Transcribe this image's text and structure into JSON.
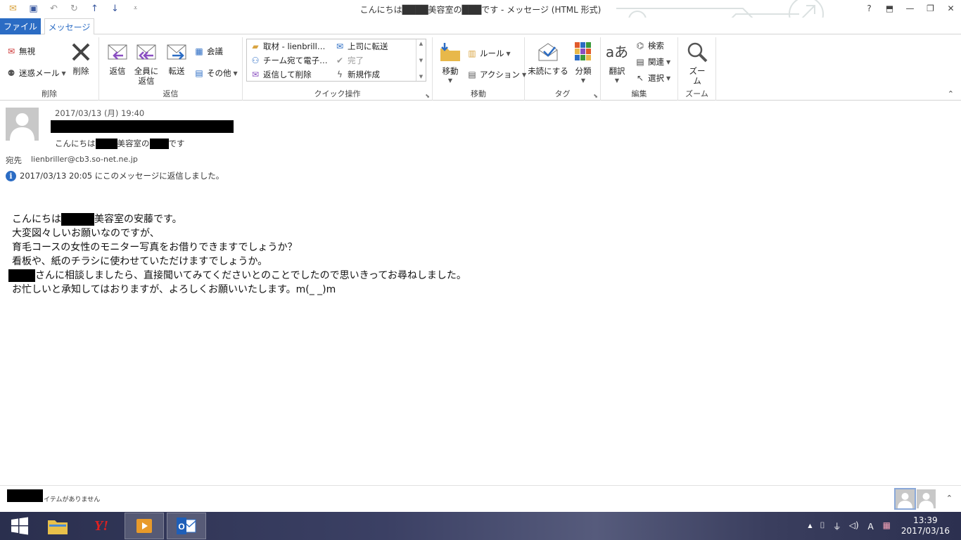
{
  "window": {
    "title": "こんにちは████美容室の███です - メッセージ (HTML 形式)",
    "controls": [
      "?",
      "⬒",
      "—",
      "❐",
      "✕"
    ]
  },
  "tabs": {
    "file": "ファイル",
    "message": "メッセージ"
  },
  "ribbon": {
    "delete_group": {
      "ignore": "無視",
      "junk": "迷惑メール",
      "delete": "削除",
      "label": "削除"
    },
    "reply_group": {
      "reply": "返信",
      "reply_all_1": "全員に",
      "reply_all_2": "返信",
      "forward": "転送",
      "meeting": "会議",
      "more": "その他",
      "label": "返信"
    },
    "quick_steps": {
      "items": [
        "取材 - lienbrill…",
        "チーム宛て電子…",
        "返信して削除",
        "上司に転送",
        "完了",
        "新規作成"
      ],
      "label": "クイック操作"
    },
    "move_group": {
      "move": "移動",
      "rules": "ルール",
      "actions": "アクション",
      "label": "移動"
    },
    "tags_group": {
      "unread": "未読にする",
      "categorize": "分類",
      "label": "タグ"
    },
    "edit_group": {
      "translate": "翻訳",
      "find": "検索",
      "related": "関連",
      "select": "選択",
      "label": "編集"
    },
    "zoom_group": {
      "zoom": "ズーム",
      "label": "ズーム"
    }
  },
  "message": {
    "date": "2017/03/13 (月) 19:40",
    "subject_prefix": "こんにちは",
    "subject_mid": "美容室の",
    "subject_suffix": "です",
    "to_label": "宛先",
    "to_address": "lienbriller@cb3.so-net.ne.jp",
    "info": "2017/03/13 20:05 にこのメッセージに返信しました。"
  },
  "body": {
    "line1_prefix": "こんにちは",
    "line1_suffix": "美容室の安藤です。",
    "line2": "大変図々しいお願いなのですが、",
    "line3": "育毛コースの女性のモニター写真をお借りできますでしょうか？",
    "line4": "看板や、紙のチラシに使わせていただけますでしょうか。",
    "line5_suffix": "さんに相談しましたら、直接聞いてみてくださいとのことでしたので思いきってお尋ねしました。",
    "line6": "お忙しいと承知してはおりますが、よろしくお願いいたします。m(_ _)m"
  },
  "status": {
    "text": "イテムがありません"
  },
  "taskbar": {
    "tray": [
      "▲",
      "⌷",
      "⏚",
      "◁)",
      "Ａ",
      "▦"
    ],
    "time": "13:39",
    "date": "2017/03/16"
  },
  "colors": {
    "accent": "#2b6cc4",
    "taskbar": "#3b4064"
  }
}
